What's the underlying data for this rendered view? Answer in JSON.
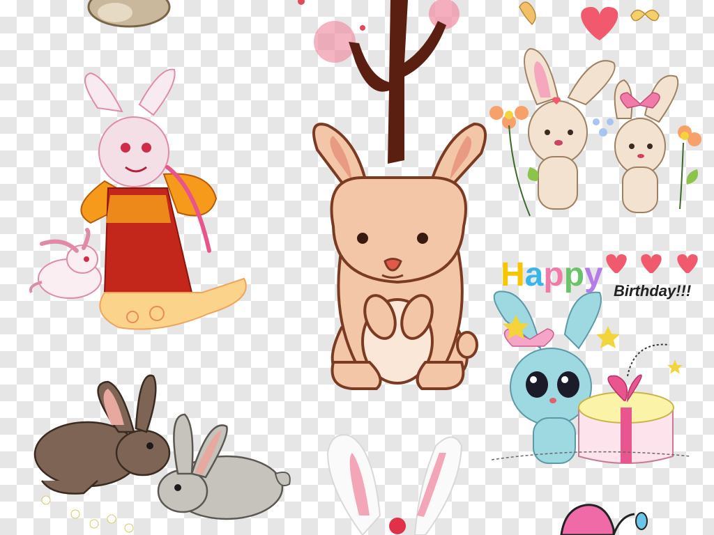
{
  "card": {
    "greeting_word": "Happy",
    "greeting_rest": "Birthday!!!",
    "letter_colors": [
      "#f7c600",
      "#38b6e8",
      "#f07aa8",
      "#6ac36a",
      "#b57be8"
    ]
  },
  "palette": {
    "brown_outline": "#7a3b22",
    "bunny_fill": "#f2c6a6",
    "belly_fill": "#fbe7d7",
    "tree_trunk": "#5a1f10",
    "pink_blossom": "#f08ca2",
    "heart_red": "#f0596e",
    "robe_orange": "#f59a1b",
    "robe_red": "#c3271c",
    "blue_bunny": "#9ed8e0",
    "gift_yellow": "#fbf3a8",
    "gift_ribbon": "#e9558f"
  },
  "icons": [
    "brown-rabbit",
    "grey-rabbit",
    "white-bunny-ears",
    "pink-bow",
    "gift-box",
    "star",
    "heart",
    "butterfly",
    "flower",
    "cloud"
  ]
}
